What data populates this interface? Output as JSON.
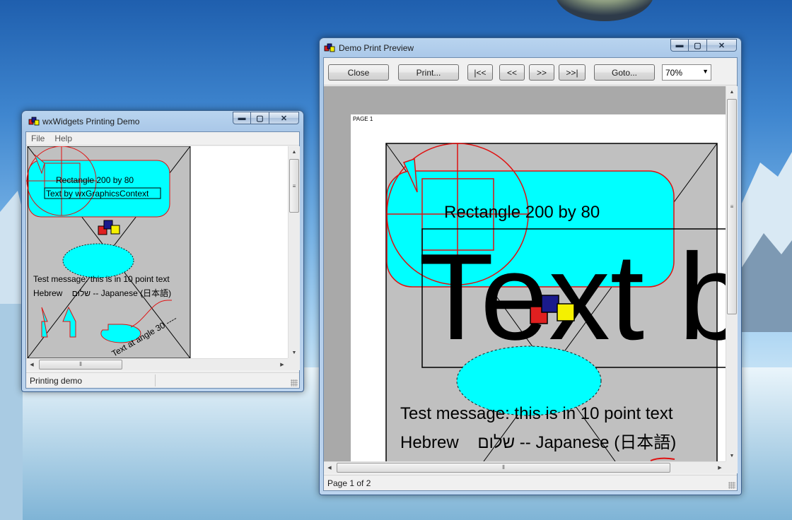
{
  "demo_window": {
    "title": "wxWidgets Printing Demo",
    "menu": [
      "File",
      "Help"
    ],
    "canvas": {
      "rect_label": "Rectangle 200 by 80",
      "gc_text": "Text by wxGraphicsContext",
      "test_message": "Test message: this is in 10 point text",
      "hebrew_line": "Hebrew    שלום -- Japanese (日本語)",
      "angle_text": "Text at angle 30 ----"
    },
    "status": "Printing demo"
  },
  "preview_window": {
    "title": "Demo Print Preview",
    "toolbar": {
      "close": "Close",
      "print": "Print...",
      "first": "|<<",
      "prev": "<<",
      "next": ">>",
      "last": ">>|",
      "goto": "Goto...",
      "zoom": "70%"
    },
    "page": {
      "header": "PAGE 1",
      "rect_label": "Rectangle 200 by 80",
      "big_text": "Text b",
      "test_message": "Test message: this is in 10 point text",
      "hebrew_line": "Hebrew    שלום -- Japanese (日本語)"
    },
    "status": "Page 1 of 2"
  },
  "caption_glyphs": {
    "minimize": "▬",
    "maximize": "▢",
    "close": "✕"
  },
  "scroll_glyphs": {
    "up": "▲",
    "down": "▼",
    "left": "◀",
    "right": "▶",
    "grip_v": "≡",
    "grip_h": "⦀"
  }
}
